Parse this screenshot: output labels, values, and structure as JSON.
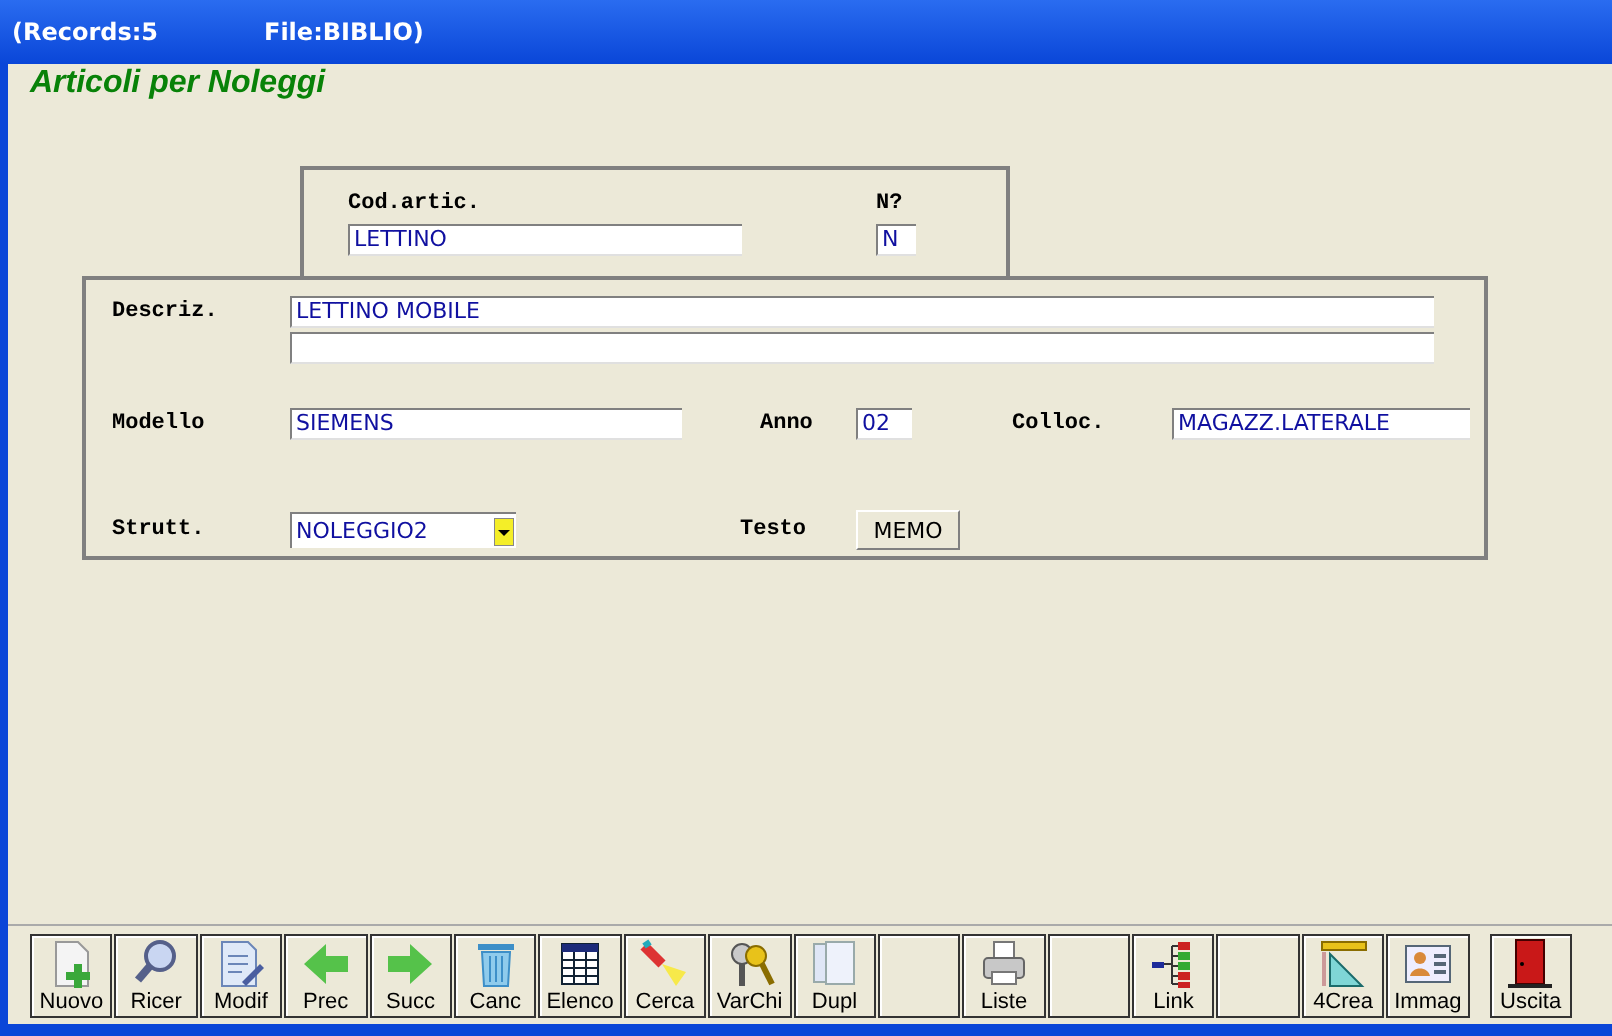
{
  "window": {
    "title_left": "(Records:5",
    "title_right": "File:BIBLIO)"
  },
  "form_title": "Articoli per Noleggi",
  "header": {
    "code_label": "Cod.artic.",
    "code_value": "LETTINO",
    "n_label": "N?",
    "n_value": "N"
  },
  "details": {
    "description_label": "Descriz.",
    "description_value": "LETTINO MOBILE",
    "model_label": "Modello",
    "model_value": "SIEMENS",
    "year_label": "Anno",
    "year_value": "02",
    "location_label": "Colloc.",
    "location_value": "MAGAZZ.LATERALE",
    "structure_label": "Strutt.",
    "structure_value": "NOLEGGIO2",
    "text_label": "Testo",
    "memo_button": "MEMO"
  },
  "toolbar": [
    {
      "label": "Nuovo",
      "kind": "tool"
    },
    {
      "label": "Ricer",
      "kind": "tool"
    },
    {
      "label": "Modif",
      "kind": "tool"
    },
    {
      "label": "Prec",
      "kind": "tool"
    },
    {
      "label": "Succ",
      "kind": "tool"
    },
    {
      "label": "Canc",
      "kind": "tool"
    },
    {
      "label": "Elenco",
      "kind": "tool"
    },
    {
      "label": "Cerca",
      "kind": "tool"
    },
    {
      "label": "VarChi",
      "kind": "tool"
    },
    {
      "label": "Dupl",
      "kind": "tool"
    },
    {
      "kind": "blank"
    },
    {
      "label": "Liste",
      "kind": "tool"
    },
    {
      "kind": "blank"
    },
    {
      "label": "Link",
      "kind": "tool"
    },
    {
      "kind": "blank"
    },
    {
      "label": "4Crea",
      "kind": "tool"
    },
    {
      "label": "Immag",
      "kind": "tool"
    },
    {
      "label": "Uscita",
      "kind": "exit"
    }
  ]
}
